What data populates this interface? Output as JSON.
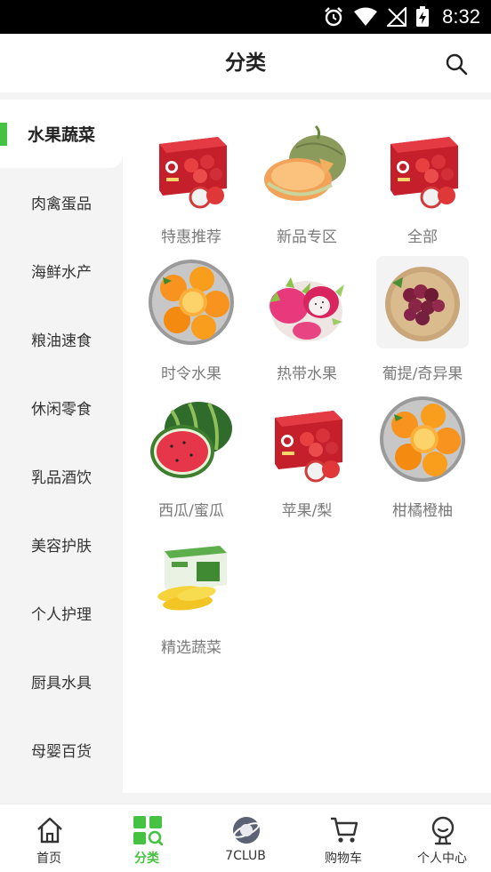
{
  "status_bar": {
    "time": "8:32"
  },
  "header": {
    "title": "分类"
  },
  "sidebar": {
    "items": [
      {
        "label": "水果蔬菜",
        "active": true
      },
      {
        "label": "肉禽蛋品"
      },
      {
        "label": "海鲜水产"
      },
      {
        "label": "粮油速食"
      },
      {
        "label": "休闲零食"
      },
      {
        "label": "乳品酒饮"
      },
      {
        "label": "美容护肤"
      },
      {
        "label": "个人护理"
      },
      {
        "label": "厨具水具"
      },
      {
        "label": "母婴百货"
      }
    ]
  },
  "grid": {
    "items": [
      {
        "label": "特惠推荐",
        "icon": "apple-box-image"
      },
      {
        "label": "新品专区",
        "icon": "melon-image"
      },
      {
        "label": "全部",
        "icon": "apple-box-image"
      },
      {
        "label": "时令水果",
        "icon": "oranges-image"
      },
      {
        "label": "热带水果",
        "icon": "dragon-fruit-image"
      },
      {
        "label": "葡提/奇异果",
        "icon": "grapes-image"
      },
      {
        "label": "西瓜/蜜瓜",
        "icon": "watermelon-image"
      },
      {
        "label": "苹果/梨",
        "icon": "apple-box-image"
      },
      {
        "label": "柑橘橙柚",
        "icon": "oranges-image"
      },
      {
        "label": "精选蔬菜",
        "icon": "corn-image"
      }
    ]
  },
  "tabbar": {
    "items": [
      {
        "label": "首页",
        "icon": "home-icon"
      },
      {
        "label": "分类",
        "icon": "category-icon",
        "active": true
      },
      {
        "label": "7CLUB",
        "icon": "planet-icon"
      },
      {
        "label": "购物车",
        "icon": "cart-icon"
      },
      {
        "label": "个人中心",
        "icon": "profile-icon"
      }
    ]
  },
  "colors": {
    "accent": "#45c241",
    "sidebar_bg": "#f4f4f4",
    "label_gray": "#7a7a7a"
  }
}
